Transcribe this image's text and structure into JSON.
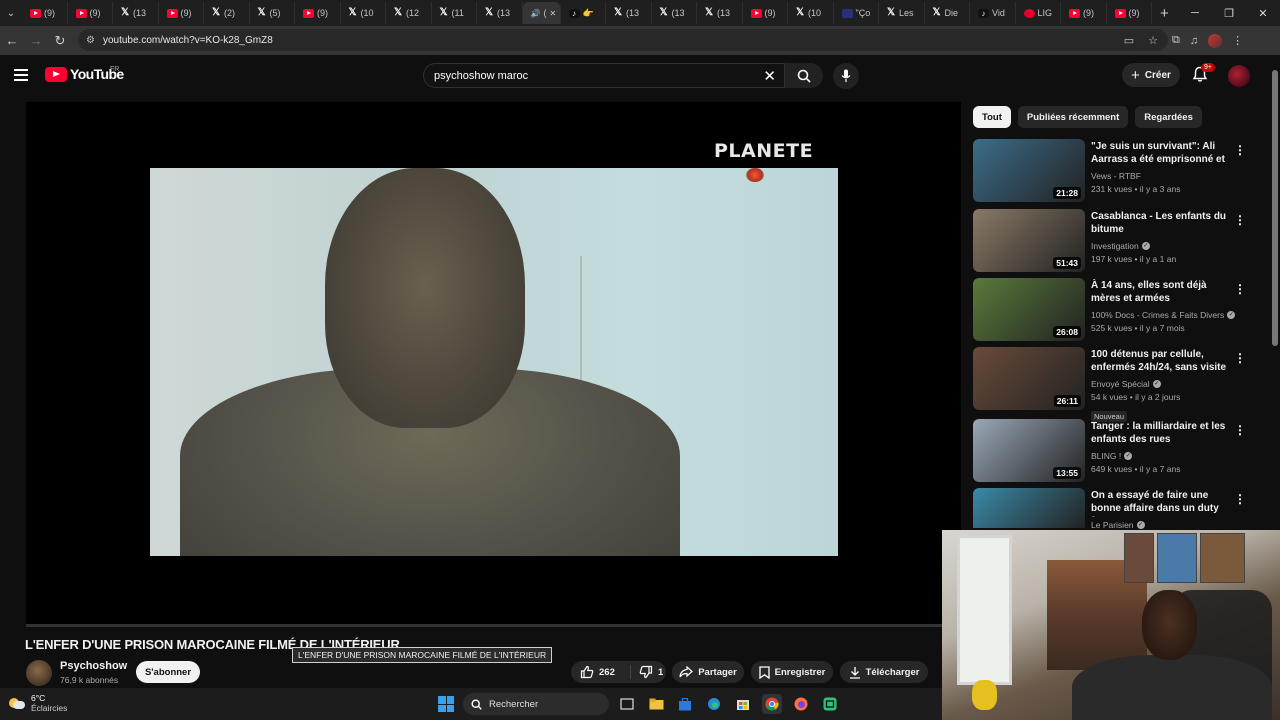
{
  "browser": {
    "tabs": [
      {
        "icon": "youtube",
        "label": "(9)"
      },
      {
        "icon": "youtube",
        "label": "(9)"
      },
      {
        "icon": "x",
        "label": "(13"
      },
      {
        "icon": "youtube",
        "label": "(9)"
      },
      {
        "icon": "x",
        "label": "(2)"
      },
      {
        "icon": "x",
        "label": "(5)"
      },
      {
        "icon": "youtube",
        "label": "(9)"
      },
      {
        "icon": "x",
        "label": "(10"
      },
      {
        "icon": "x",
        "label": "(12"
      },
      {
        "icon": "x",
        "label": "(11"
      },
      {
        "icon": "x",
        "label": "(13"
      },
      {
        "icon": "active",
        "label": "(",
        "active": true
      },
      {
        "icon": "tiktok",
        "label": "👉"
      },
      {
        "icon": "x",
        "label": "(13"
      },
      {
        "icon": "x",
        "label": "(13"
      },
      {
        "icon": "x",
        "label": "(13"
      },
      {
        "icon": "youtube",
        "label": "(9)"
      },
      {
        "icon": "x",
        "label": "(10"
      },
      {
        "icon": "flag",
        "label": "\"Ço"
      },
      {
        "icon": "x",
        "label": "Les"
      },
      {
        "icon": "x",
        "label": "Die"
      },
      {
        "icon": "tiktok",
        "label": "Vid"
      },
      {
        "icon": "logo-red",
        "label": "LIG"
      },
      {
        "icon": "youtube",
        "label": "(9)"
      },
      {
        "icon": "youtube",
        "label": "(9)"
      }
    ],
    "url": "youtube.com/watch?v=KO-k28_GmZ8"
  },
  "header": {
    "logo_text": "YouTube",
    "country": "FR",
    "search_value": "psychoshow maroc",
    "create_label": "Créer",
    "notif_count": "9+"
  },
  "player": {
    "watermark": "PLANETE"
  },
  "video": {
    "title": "L'ENFER D'UNE PRISON MAROCAINE FILMÉ DE L'INTÉRIEUR",
    "tooltip": "L'ENFER D'UNE PRISON MAROCAINE FILMÉ DE L'INTÉRIEUR",
    "channel": "Psychoshow",
    "subscribers": "76,9 k abonnés",
    "subscribe_label": "S'abonner",
    "likes": "262",
    "dislikes": "1",
    "share_label": "Partager",
    "save_label": "Enregistrer",
    "download_label": "Télécharger"
  },
  "chips": [
    "Tout",
    "Publiées récemment",
    "Regardées"
  ],
  "recommendations": [
    {
      "title": "\"Je suis un survivant\": Ali Aarrass a été emprisonné et ...",
      "channel": "Vews - RTBF",
      "verified": false,
      "views": "231 k vues • il y a 3 ans",
      "duration": "21:28",
      "thumb": "#3b6d8a"
    },
    {
      "title": "Casablanca - Les enfants du bitume",
      "channel": "Investigation",
      "verified": true,
      "views": "197 k vues • il y a 1 an",
      "duration": "51:43",
      "thumb": "#8a7a66"
    },
    {
      "title": "À 14 ans, elles sont déjà mères et armées",
      "channel": "100% Docs - Crimes & Faits Divers",
      "verified": true,
      "views": "525 k vues • il y a 7 mois",
      "duration": "26:08",
      "thumb": "#5a7a3a"
    },
    {
      "title": "100 détenus par cellule, enfermés 24h/24, sans visite ...",
      "channel": "Envoyé Spécial",
      "verified": true,
      "views": "54 k vues • il y a 2 jours",
      "duration": "26:11",
      "badge": "Nouveau",
      "thumb": "#6a4a3a"
    },
    {
      "title": "Tanger : la milliardaire et les enfants des rues",
      "channel": "BLING !",
      "verified": true,
      "views": "649 k vues • il y a 7 ans",
      "duration": "13:55",
      "thumb": "#9aa8b8"
    },
    {
      "title": "On a essayé de faire une bonne affaire dans un duty free",
      "channel": "Le Parisien",
      "verified": true,
      "views": "",
      "duration": "",
      "thumb": "#3a8aa8"
    }
  ],
  "taskbar": {
    "temp": "6°C",
    "weather": "Éclaircies",
    "search_label": "Rechercher"
  }
}
